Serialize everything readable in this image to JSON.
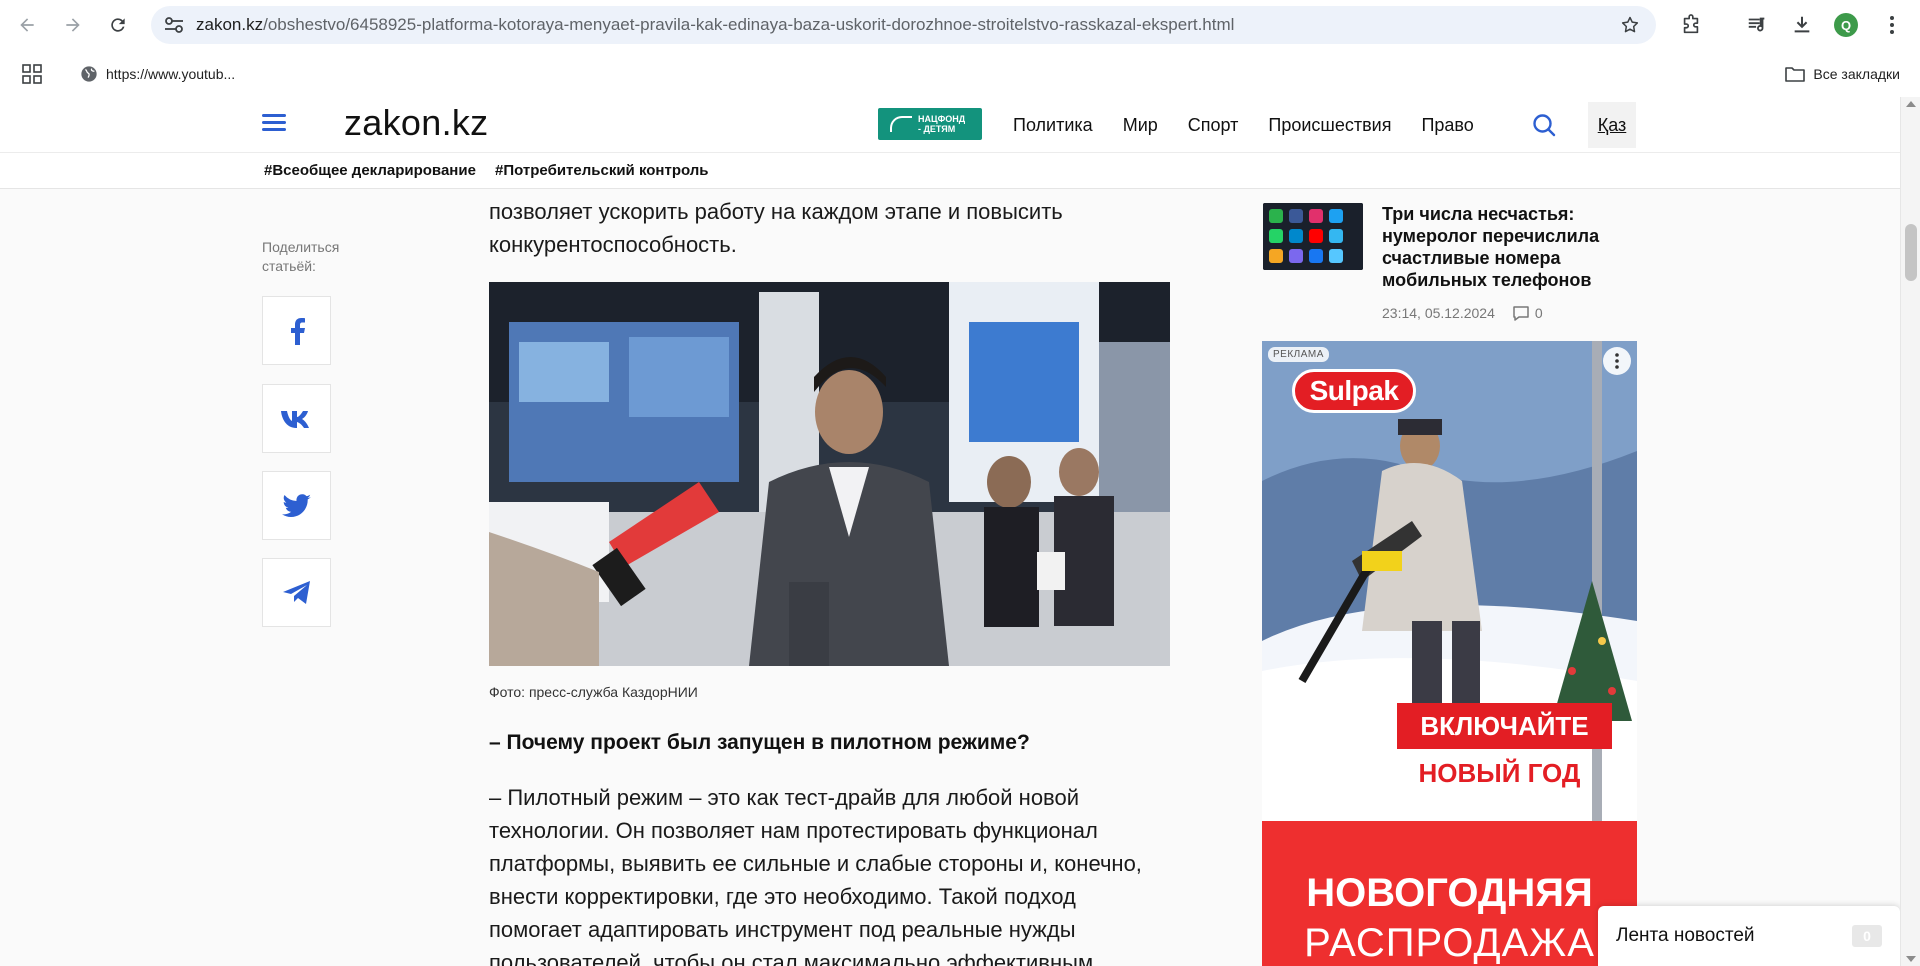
{
  "browser": {
    "url_domain": "zakon.kz",
    "url_path": "/obshestvo/6458925-platforma-kotoraya-menyaet-pravila-kak-edinaya-baza-uskorit-dorozhnoe-stroitelstvo-rasskazal-ekspert.html",
    "profile_initial": "Q"
  },
  "bookmarks": {
    "item": "https://www.youtub...",
    "all": "Все закладки"
  },
  "site": {
    "logo": "zakon.kz",
    "natfond_line1": "НАЦФОНД",
    "natfond_line2": "- ДЕТЯМ",
    "nav": [
      "Политика",
      "Мир",
      "Спорт",
      "Происшествия",
      "Право"
    ],
    "lang": "Қаз",
    "tags": [
      "#Всеобщее декларирование",
      "#Потребительский контроль"
    ]
  },
  "share": {
    "label": "Поделиться статьёй:"
  },
  "article": {
    "para_top_1": "позволяет ускорить работу на каждом этапе и повысить",
    "para_top_2": "конкурентоспособность.",
    "caption": "Фото: пресс-служба КаздорНИИ",
    "subhead": "– Почему проект был запущен в пилотном режиме?",
    "answer_lines": [
      "– Пилотный режим – это как тест-драйв для любой новой",
      "технологии. Он позволяет нам протестировать функционал",
      "платформы, выявить ее сильные и слабые стороны и, конечно,",
      "внести корректировки, где это необходимо. Такой подход",
      "помогает адаптировать инструмент под реальные нужды",
      "пользователей, чтобы он стал максимально эффективным."
    ]
  },
  "sidebar": {
    "news_title": "Три числа несчастья: нумеролог перечислила счастливые номера мобильных телефонов",
    "news_time": "23:14, 05.12.2024",
    "news_comments": "0"
  },
  "ad": {
    "badge": "РЕКЛАМА",
    "logo": "Sulpak",
    "cta1": "ВКЛЮЧАЙТЕ",
    "cta2": "НОВЫЙ ГОД",
    "big1": "НОВОГОДНЯЯ",
    "big2": "РАСПРОДАЖА"
  },
  "news_feed": {
    "label": "Лента новостей",
    "count": "0"
  },
  "colors": {
    "accent_blue": "#2d5fd1",
    "natfond_green": "#13937d",
    "ad_red": "#e31e24"
  }
}
